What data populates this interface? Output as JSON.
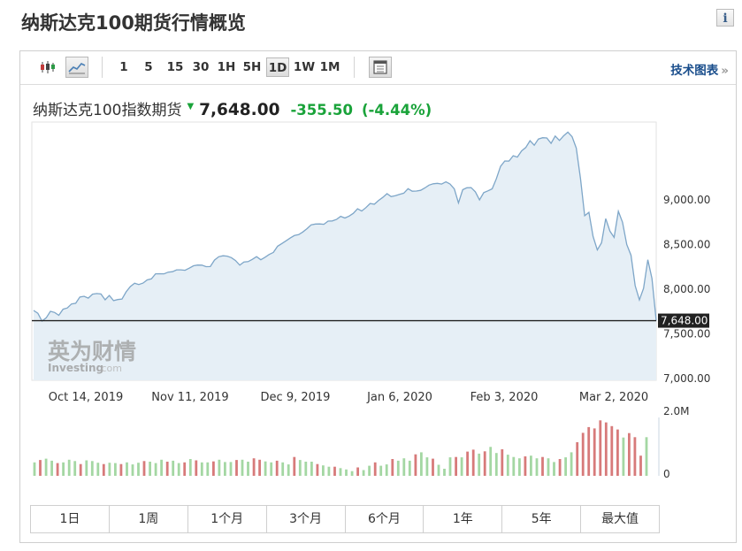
{
  "page": {
    "title": "纳斯达克100期货行情概览",
    "info_icon": "i"
  },
  "toolbar": {
    "chart_type_icons": [
      "candlestick-icon",
      "area-chart-icon"
    ],
    "timeframes": [
      "1",
      "5",
      "15",
      "30",
      "1H",
      "5H",
      "1D",
      "1W",
      "1M"
    ],
    "active_timeframe": "1D",
    "table_icon": "table-icon",
    "tech_chart_label": "技术图表",
    "tech_chart_arrow": "»"
  },
  "quote": {
    "name": "纳斯达克100指数期货",
    "price": "7,648.00",
    "change": "-355.50",
    "change_pct": "(-4.44%)",
    "direction_icon": "down-arrow-icon",
    "color_down": "#1aa33a"
  },
  "chart_data": {
    "type": "area",
    "x_tick_labels": [
      "Oct 14, 2019",
      "Nov 11, 2019",
      "Dec 9, 2019",
      "Jan 6, 2020",
      "Feb 3, 2020",
      "Mar 2, 2020"
    ],
    "y_tick_labels": [
      "9,000.00",
      "8,500.00",
      "8,000.00",
      "7,500.00",
      "7,000.00"
    ],
    "ylim": [
      7000,
      9950
    ],
    "current_value_label": "7,648.00",
    "current_value": 7648,
    "watermark": {
      "brand_cn": "英为财情",
      "brand_en": "Investing",
      "brand_suffix": ".com"
    },
    "price_series": [
      7762,
      7731,
      7644,
      7680,
      7752,
      7740,
      7708,
      7776,
      7790,
      7835,
      7843,
      7913,
      7921,
      7900,
      7945,
      7951,
      7947,
      7881,
      7930,
      7872,
      7884,
      7889,
      7970,
      8030,
      8067,
      8052,
      8068,
      8104,
      8116,
      8172,
      8173,
      8172,
      8191,
      8196,
      8217,
      8217,
      8212,
      8236,
      8262,
      8270,
      8269,
      8252,
      8253,
      8326,
      8363,
      8374,
      8370,
      8353,
      8321,
      8269,
      8305,
      8309,
      8335,
      8364,
      8330,
      8357,
      8389,
      8412,
      8481,
      8511,
      8542,
      8573,
      8601,
      8611,
      8641,
      8678,
      8721,
      8730,
      8731,
      8727,
      8762,
      8764,
      8781,
      8816,
      8797,
      8819,
      8850,
      8900,
      8875,
      8914,
      8959,
      8951,
      8994,
      9028,
      9069,
      9037,
      9047,
      9061,
      9075,
      9126,
      9097,
      9099,
      9107,
      9134,
      9165,
      9180,
      9185,
      9177,
      9202,
      9177,
      9123,
      8966,
      9114,
      9136,
      9138,
      9090,
      9000,
      9081,
      9101,
      9124,
      9236,
      9375,
      9436,
      9435,
      9494,
      9479,
      9549,
      9586,
      9662,
      9612,
      9681,
      9696,
      9693,
      9633,
      9715,
      9665,
      9718,
      9758,
      9707,
      9580,
      9238,
      8823,
      8860,
      8591,
      8440,
      8520,
      8790,
      8650,
      8580,
      8872,
      8750,
      8500,
      8380,
      8040,
      7880,
      8010,
      8330,
      8120,
      7648
    ],
    "volume_axis_labels": [
      "2.0M",
      "0"
    ],
    "volume_ylim": [
      0,
      2000000
    ],
    "volume_colors": {
      "up": "#a4d7a3",
      "down": "#d77a7a"
    },
    "volume_series": [
      {
        "v": 400000,
        "d": "u"
      },
      {
        "v": 470000,
        "d": "d"
      },
      {
        "v": 510000,
        "d": "u"
      },
      {
        "v": 450000,
        "d": "u"
      },
      {
        "v": 380000,
        "d": "d"
      },
      {
        "v": 400000,
        "d": "u"
      },
      {
        "v": 480000,
        "d": "u"
      },
      {
        "v": 440000,
        "d": "u"
      },
      {
        "v": 350000,
        "d": "d"
      },
      {
        "v": 460000,
        "d": "u"
      },
      {
        "v": 440000,
        "d": "u"
      },
      {
        "v": 390000,
        "d": "u"
      },
      {
        "v": 350000,
        "d": "d"
      },
      {
        "v": 390000,
        "d": "u"
      },
      {
        "v": 380000,
        "d": "u"
      },
      {
        "v": 350000,
        "d": "d"
      },
      {
        "v": 400000,
        "d": "u"
      },
      {
        "v": 340000,
        "d": "u"
      },
      {
        "v": 390000,
        "d": "u"
      },
      {
        "v": 440000,
        "d": "d"
      },
      {
        "v": 420000,
        "d": "u"
      },
      {
        "v": 380000,
        "d": "u"
      },
      {
        "v": 480000,
        "d": "u"
      },
      {
        "v": 420000,
        "d": "d"
      },
      {
        "v": 450000,
        "d": "u"
      },
      {
        "v": 380000,
        "d": "u"
      },
      {
        "v": 400000,
        "d": "d"
      },
      {
        "v": 500000,
        "d": "u"
      },
      {
        "v": 460000,
        "d": "d"
      },
      {
        "v": 400000,
        "d": "u"
      },
      {
        "v": 400000,
        "d": "u"
      },
      {
        "v": 430000,
        "d": "d"
      },
      {
        "v": 480000,
        "d": "u"
      },
      {
        "v": 410000,
        "d": "u"
      },
      {
        "v": 410000,
        "d": "u"
      },
      {
        "v": 470000,
        "d": "d"
      },
      {
        "v": 480000,
        "d": "u"
      },
      {
        "v": 420000,
        "d": "u"
      },
      {
        "v": 520000,
        "d": "d"
      },
      {
        "v": 480000,
        "d": "d"
      },
      {
        "v": 430000,
        "d": "u"
      },
      {
        "v": 400000,
        "d": "u"
      },
      {
        "v": 450000,
        "d": "d"
      },
      {
        "v": 400000,
        "d": "u"
      },
      {
        "v": 340000,
        "d": "u"
      },
      {
        "v": 560000,
        "d": "d"
      },
      {
        "v": 470000,
        "d": "u"
      },
      {
        "v": 420000,
        "d": "u"
      },
      {
        "v": 420000,
        "d": "u"
      },
      {
        "v": 350000,
        "d": "d"
      },
      {
        "v": 310000,
        "d": "u"
      },
      {
        "v": 270000,
        "d": "u"
      },
      {
        "v": 270000,
        "d": "d"
      },
      {
        "v": 230000,
        "d": "u"
      },
      {
        "v": 190000,
        "d": "u"
      },
      {
        "v": 140000,
        "d": "u"
      },
      {
        "v": 250000,
        "d": "d"
      },
      {
        "v": 170000,
        "d": "u"
      },
      {
        "v": 300000,
        "d": "u"
      },
      {
        "v": 400000,
        "d": "d"
      },
      {
        "v": 300000,
        "d": "u"
      },
      {
        "v": 340000,
        "d": "u"
      },
      {
        "v": 500000,
        "d": "d"
      },
      {
        "v": 450000,
        "d": "u"
      },
      {
        "v": 520000,
        "d": "u"
      },
      {
        "v": 450000,
        "d": "u"
      },
      {
        "v": 640000,
        "d": "d"
      },
      {
        "v": 700000,
        "d": "u"
      },
      {
        "v": 550000,
        "d": "u"
      },
      {
        "v": 510000,
        "d": "d"
      },
      {
        "v": 330000,
        "d": "u"
      },
      {
        "v": 210000,
        "d": "u"
      },
      {
        "v": 550000,
        "d": "u"
      },
      {
        "v": 560000,
        "d": "d"
      },
      {
        "v": 550000,
        "d": "u"
      },
      {
        "v": 720000,
        "d": "d"
      },
      {
        "v": 780000,
        "d": "d"
      },
      {
        "v": 660000,
        "d": "u"
      },
      {
        "v": 730000,
        "d": "d"
      },
      {
        "v": 860000,
        "d": "u"
      },
      {
        "v": 680000,
        "d": "u"
      },
      {
        "v": 790000,
        "d": "d"
      },
      {
        "v": 630000,
        "d": "u"
      },
      {
        "v": 560000,
        "d": "u"
      },
      {
        "v": 520000,
        "d": "u"
      },
      {
        "v": 580000,
        "d": "d"
      },
      {
        "v": 600000,
        "d": "u"
      },
      {
        "v": 520000,
        "d": "u"
      },
      {
        "v": 560000,
        "d": "d"
      },
      {
        "v": 520000,
        "d": "u"
      },
      {
        "v": 410000,
        "d": "u"
      },
      {
        "v": 500000,
        "d": "d"
      },
      {
        "v": 550000,
        "d": "u"
      },
      {
        "v": 700000,
        "d": "u"
      },
      {
        "v": 1000000,
        "d": "d"
      },
      {
        "v": 1280000,
        "d": "d"
      },
      {
        "v": 1450000,
        "d": "d"
      },
      {
        "v": 1410000,
        "d": "d"
      },
      {
        "v": 1650000,
        "d": "d"
      },
      {
        "v": 1590000,
        "d": "d"
      },
      {
        "v": 1480000,
        "d": "d"
      },
      {
        "v": 1380000,
        "d": "d"
      },
      {
        "v": 1140000,
        "d": "u"
      },
      {
        "v": 1270000,
        "d": "d"
      },
      {
        "v": 1150000,
        "d": "d"
      },
      {
        "v": 600000,
        "d": "d"
      },
      {
        "v": 1150000,
        "d": "u"
      }
    ]
  },
  "periods": [
    "1日",
    "1周",
    "1个月",
    "3个月",
    "6个月",
    "1年",
    "5年",
    "最大值"
  ]
}
